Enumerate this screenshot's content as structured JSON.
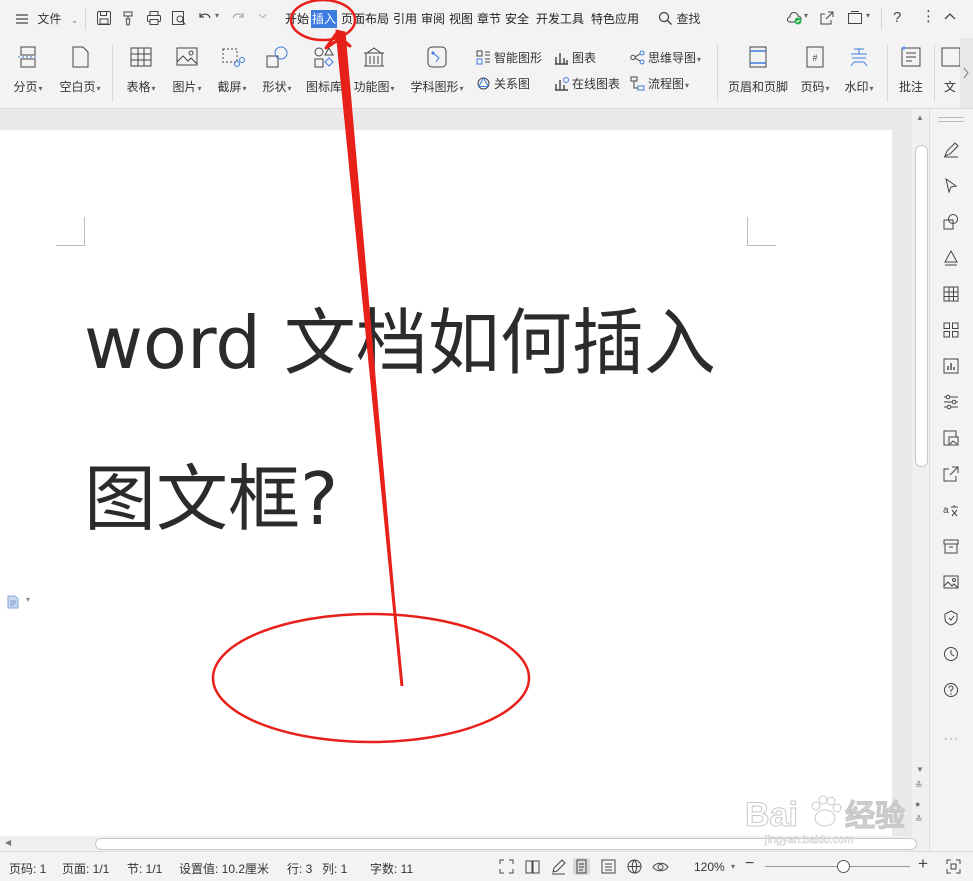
{
  "menubar": {
    "file_label": "文件",
    "tabs": [
      {
        "label": "开始",
        "active": false
      },
      {
        "label": "插入",
        "active": true
      },
      {
        "label": "页面布局",
        "active": false
      },
      {
        "label": "引用",
        "active": false
      },
      {
        "label": "审阅",
        "active": false
      },
      {
        "label": "视图",
        "active": false
      },
      {
        "label": "章节",
        "active": false
      },
      {
        "label": "安全",
        "active": false
      },
      {
        "label": "开发工具",
        "active": false
      },
      {
        "label": "特色应用",
        "active": false
      }
    ],
    "search_label": "查找"
  },
  "ribbon": {
    "page_break": "分页",
    "blank_page": "空白页",
    "table": "表格",
    "picture": "图片",
    "screenshot": "截屏",
    "shape": "形状",
    "icon_lib": "图标库",
    "function_chart": "功能图",
    "science_shape": "学科图形",
    "smart_shape": "智能图形",
    "chart": "图表",
    "mind_map": "思维导图",
    "relation_map": "关系图",
    "online_chart": "在线图表",
    "flow_chart": "流程图",
    "header_footer": "页眉和页脚",
    "page_number": "页码",
    "watermark": "水印",
    "comment": "批注",
    "textbox": "文"
  },
  "document": {
    "line1": "word 文档如何插入",
    "line2": "图文框?"
  },
  "statusbar": {
    "page_num": "页码: 1",
    "pages": "页面: 1/1",
    "section": "节: 1/1",
    "setting": "设置值: 10.2厘米",
    "row": "行: 3",
    "col": "列: 1",
    "word_count": "字数: 11",
    "zoom": "120%"
  },
  "watermark_text": "Bai经验 jingyan.baidu.com",
  "colors": {
    "accent": "#3c7be0",
    "annotation": "#e8201a"
  }
}
